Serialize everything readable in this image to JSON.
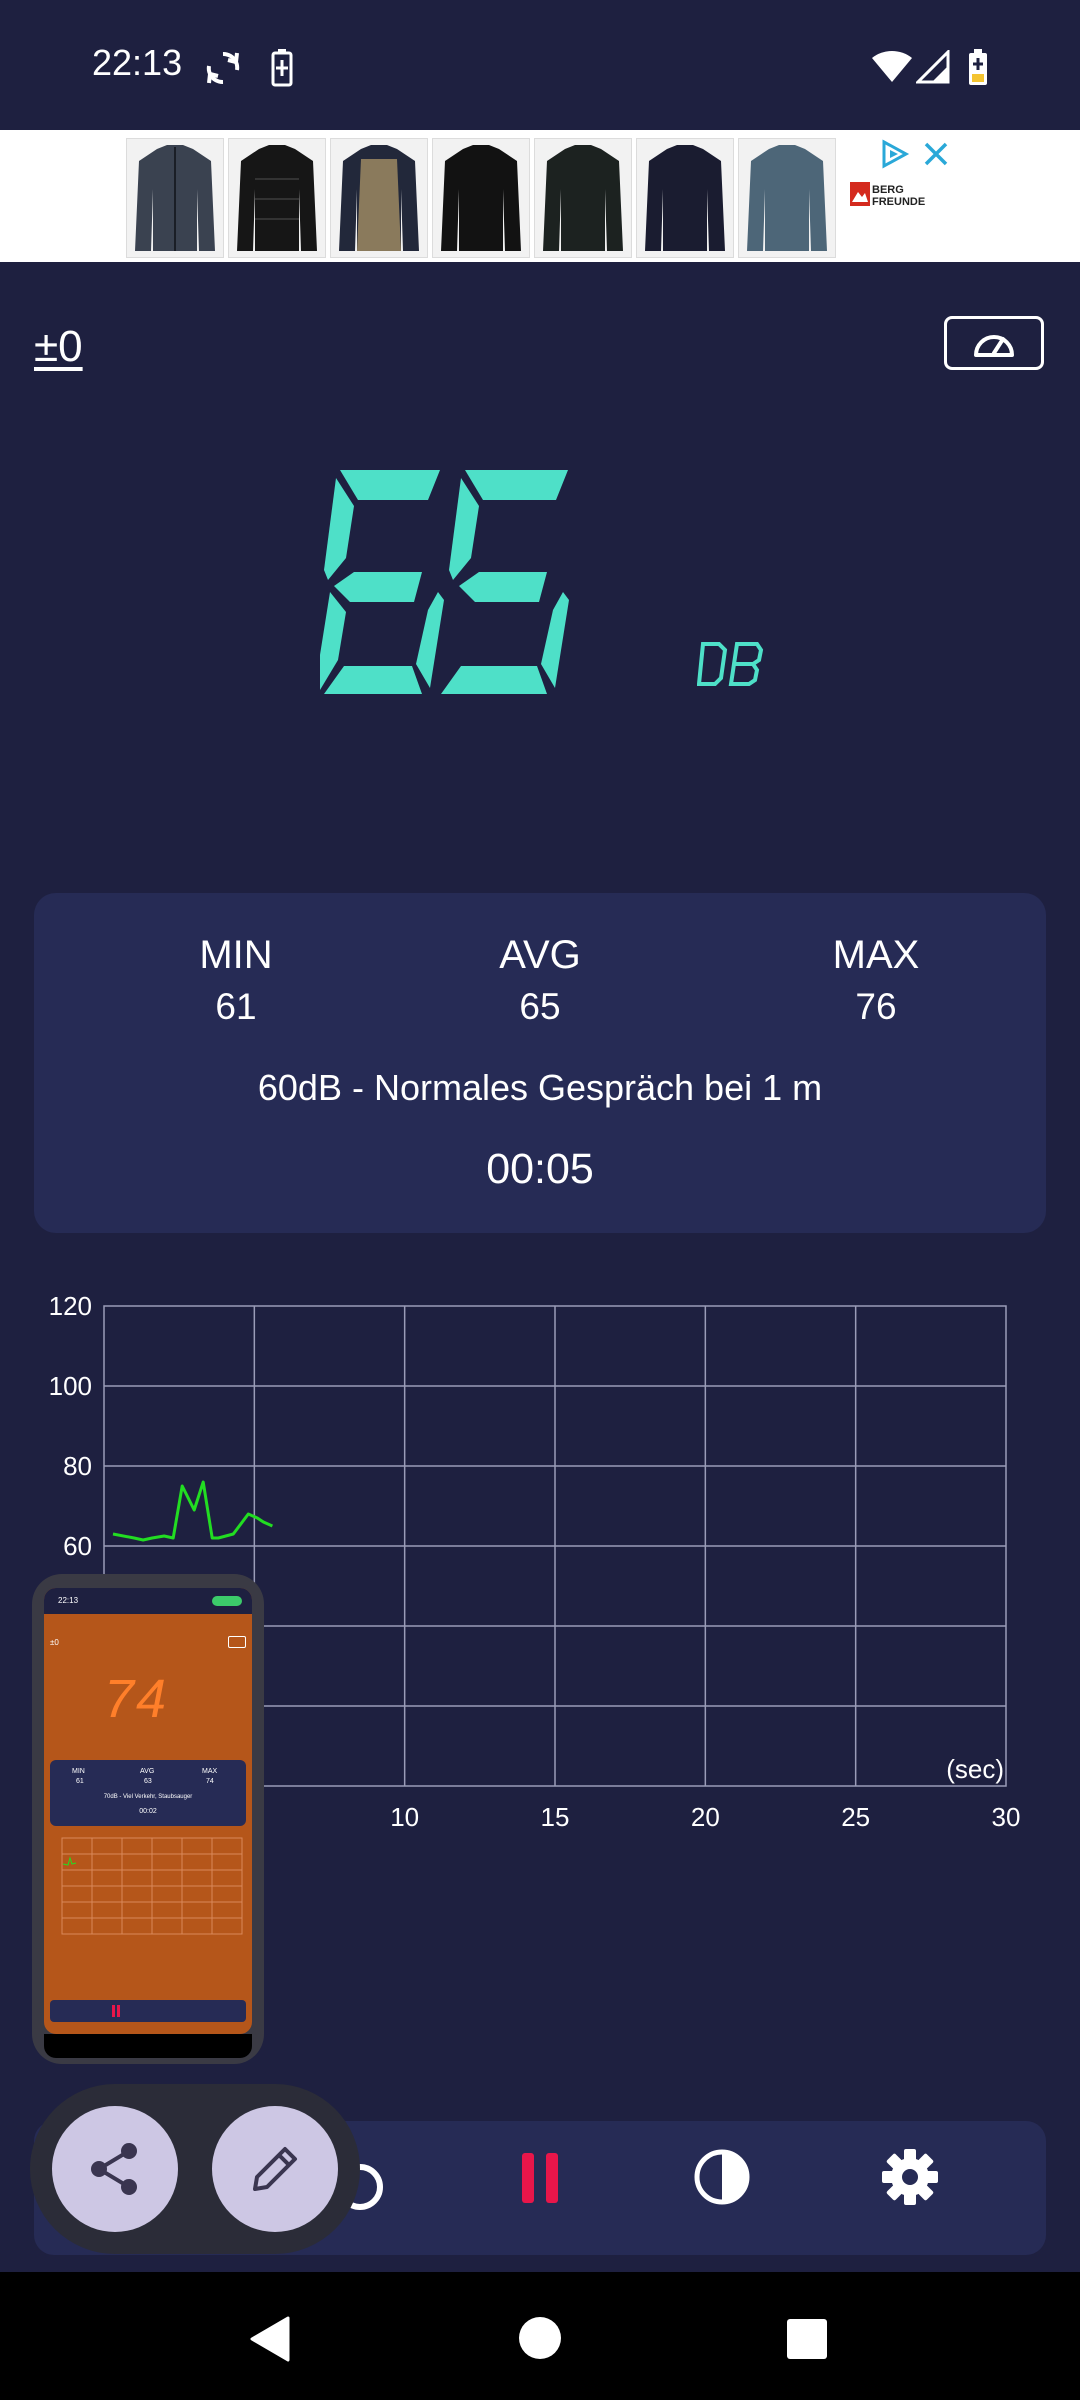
{
  "status_bar": {
    "time": "22:13",
    "icons": [
      "sync-icon",
      "battery-saver-icon",
      "wifi-icon",
      "cell-signal-icon",
      "battery-charging-icon"
    ]
  },
  "ad": {
    "brand": "BERG FREUNDE",
    "products": [
      "jacket-1",
      "jacket-2",
      "jacket-3",
      "jacket-4",
      "jacket-5",
      "jacket-6",
      "jacket-7"
    ],
    "icons": [
      "adchoices-icon",
      "close-icon"
    ]
  },
  "calibration": {
    "label": "±0"
  },
  "meter": {
    "value": "65",
    "unit": "DB",
    "accent": "#4ee0c8"
  },
  "stats": {
    "min_label": "MIN",
    "min_value": "61",
    "avg_label": "AVG",
    "avg_value": "65",
    "max_label": "MAX",
    "max_value": "76",
    "description": "60dB - Normales Gespräch bei 1 m",
    "elapsed": "00:05"
  },
  "chart_data": {
    "type": "line",
    "xlabel": "(sec)",
    "ylabel": "",
    "xlim": [
      0,
      30
    ],
    "ylim": [
      0,
      120
    ],
    "y_ticks": [
      "120",
      "100",
      "80",
      "60"
    ],
    "x_ticks": [
      "10",
      "15",
      "20",
      "25",
      "30"
    ],
    "grid": true,
    "series": [
      {
        "color": "#22dd22",
        "x": [
          0.3,
          1.0,
          1.3,
          1.6,
          2.0,
          2.3,
          2.6,
          3.0,
          3.3,
          3.6,
          3.8,
          4.3,
          4.8,
          5.1,
          5.3,
          5.6
        ],
        "y": [
          63,
          62,
          61.5,
          62,
          62.5,
          62,
          75,
          69,
          76,
          62,
          62,
          63,
          68,
          67,
          66,
          65
        ]
      }
    ]
  },
  "preview": {
    "time": "22:13",
    "value": "74",
    "calibration": "±0",
    "min_label": "MIN",
    "min_value": "61",
    "avg_label": "AVG",
    "avg_value": "63",
    "max_label": "MAX",
    "max_value": "74",
    "description": "70dB - Viel Verkehr, Staubsauger",
    "elapsed": "00:02",
    "bg_color": "#b5561a"
  },
  "toolbar": {
    "icons": [
      "reset-icon",
      "pause-icon",
      "contrast-icon",
      "settings-icon"
    ],
    "pause_color": "#e8164a"
  },
  "fabs": {
    "icons": [
      "share-icon",
      "edit-icon"
    ]
  },
  "navigation": {
    "icons": [
      "back-icon",
      "home-icon",
      "recents-icon"
    ]
  }
}
